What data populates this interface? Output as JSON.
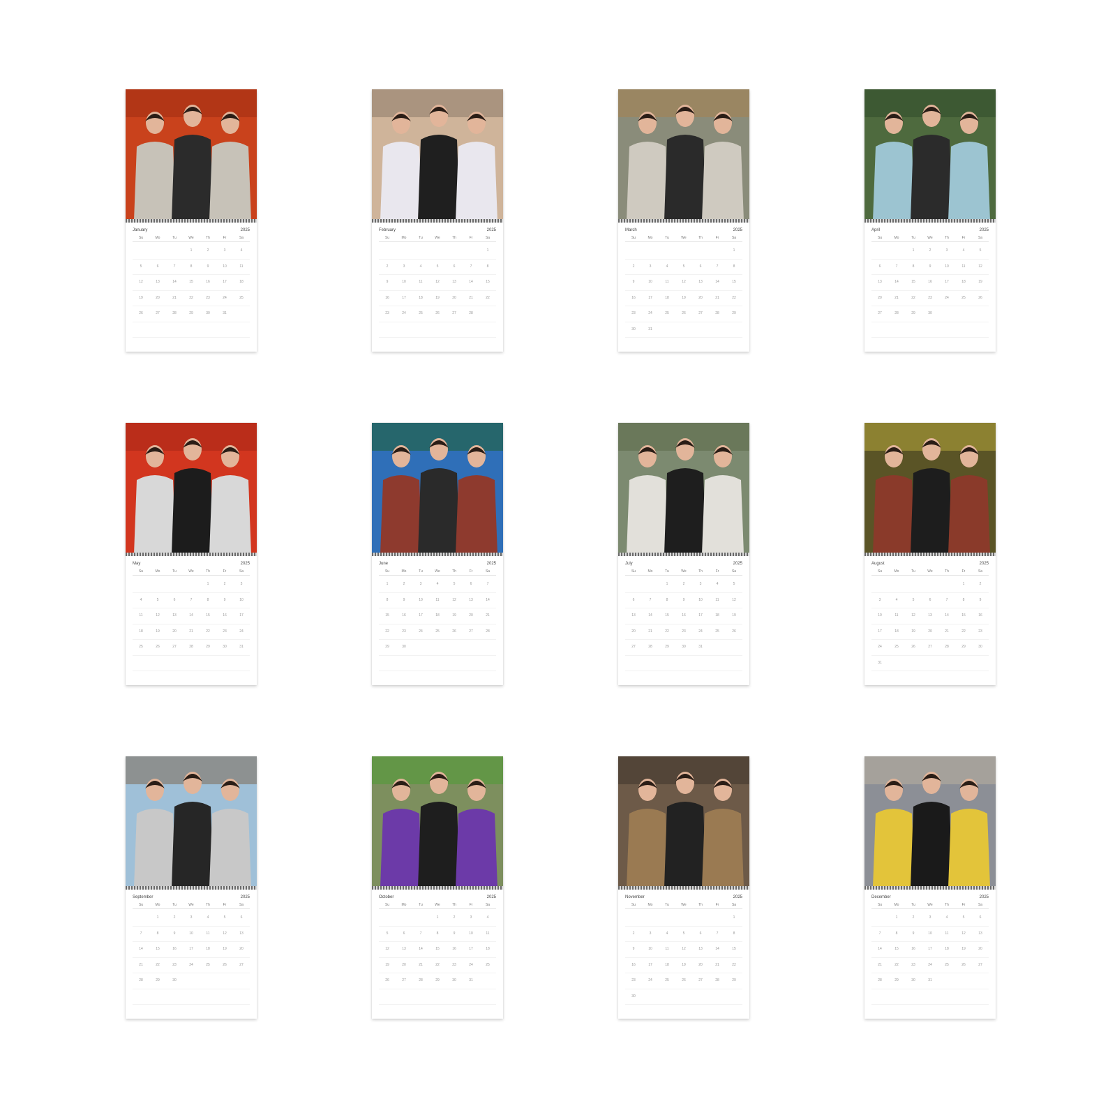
{
  "months": [
    {
      "name": "January",
      "year": "2025",
      "start": 3,
      "days": 31
    },
    {
      "name": "February",
      "year": "2025",
      "start": 6,
      "days": 28
    },
    {
      "name": "March",
      "year": "2025",
      "start": 6,
      "days": 31
    },
    {
      "name": "April",
      "year": "2025",
      "start": 2,
      "days": 30
    },
    {
      "name": "May",
      "year": "2025",
      "start": 4,
      "days": 31
    },
    {
      "name": "June",
      "year": "2025",
      "start": 0,
      "days": 30
    },
    {
      "name": "July",
      "year": "2025",
      "start": 2,
      "days": 31
    },
    {
      "name": "August",
      "year": "2025",
      "start": 5,
      "days": 31
    },
    {
      "name": "September",
      "year": "2025",
      "start": 1,
      "days": 30
    },
    {
      "name": "October",
      "year": "2025",
      "start": 3,
      "days": 31
    },
    {
      "name": "November",
      "year": "2025",
      "start": 6,
      "days": 30
    },
    {
      "name": "December",
      "year": "2025",
      "start": 1,
      "days": 31
    }
  ],
  "weekdays": [
    "Su",
    "Mo",
    "Tu",
    "We",
    "Th",
    "Fr",
    "Sa"
  ],
  "photos": [
    {
      "bg": "#c9421c",
      "accent": "#9e2d12",
      "figure": "#2b2b2b",
      "shirt": "#c7c2b8"
    },
    {
      "bg": "#cfb49a",
      "accent": "#8d7a6a",
      "figure": "#1f1f1f",
      "shirt": "#e9e7ee"
    },
    {
      "bg": "#8a8c7a",
      "accent": "#a8814e",
      "figure": "#2a2a2a",
      "shirt": "#cfcac0"
    },
    {
      "bg": "#4e6a3e",
      "accent": "#2f4a2a",
      "figure": "#2b2b2b",
      "shirt": "#9cc4d1"
    },
    {
      "bg": "#d2361f",
      "accent": "#a62716",
      "figure": "#1c1c1c",
      "shirt": "#d8d8d8"
    },
    {
      "bg": "#2f6fb8",
      "accent": "#1f5e2e",
      "figure": "#2a2a2a",
      "shirt": "#8e3a2e"
    },
    {
      "bg": "#7c8a70",
      "accent": "#5b6a48",
      "figure": "#1e1e1e",
      "shirt": "#e2e0da"
    },
    {
      "bg": "#5a5426",
      "accent": "#b6a63a",
      "figure": "#1d1d1d",
      "shirt": "#8a3a2a"
    },
    {
      "bg": "#9fc0d8",
      "accent": "#7d6a58",
      "figure": "#262626",
      "shirt": "#c8c8c8"
    },
    {
      "bg": "#7d8f5e",
      "accent": "#4f9c34",
      "figure": "#1e1e1e",
      "shirt": "#6c3aa8"
    },
    {
      "bg": "#6d5a48",
      "accent": "#3e342c",
      "figure": "#222222",
      "shirt": "#9a7a52"
    },
    {
      "bg": "#8c8f96",
      "accent": "#b9b0a0",
      "figure": "#1a1a1a",
      "shirt": "#e3c43a"
    }
  ]
}
